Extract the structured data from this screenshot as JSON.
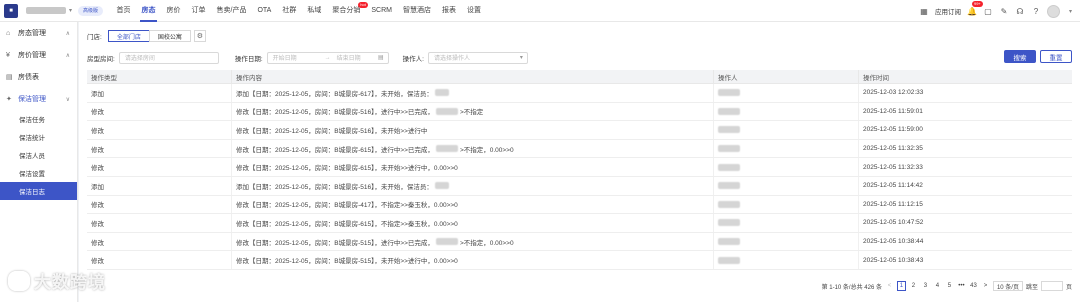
{
  "topbar": {
    "badge": "高级版",
    "nav": [
      "首页",
      "房态",
      "房价",
      "订单",
      "售卖/产品",
      "OTA",
      "社群",
      "私域",
      "聚合分销",
      "SCRM",
      "智慧酒店",
      "报表",
      "设置"
    ],
    "nav_active_index": 1,
    "hot_label": "hot",
    "hot_index": 8,
    "subscribe_label": "应用订阅",
    "notif_count": "99+"
  },
  "sidebar": {
    "items": [
      {
        "label": "房态管理",
        "icon": "home-icon",
        "chevron": "∧"
      },
      {
        "label": "房价管理",
        "icon": "price-icon",
        "chevron": "∧"
      },
      {
        "label": "房债表",
        "icon": "table-icon",
        "chevron": ""
      },
      {
        "label": "保洁管理",
        "icon": "broom-icon",
        "chevron": "∨"
      }
    ],
    "sub_items": [
      "保洁任务",
      "保洁统计",
      "保洁人员",
      "保洁设置",
      "保洁日志"
    ],
    "active_sub_index": 4
  },
  "filters": {
    "store_label": "门店:",
    "store_options": [
      "全部门店",
      "国校公寓"
    ],
    "room_label": "房型房间:",
    "room_placeholder": "请选择房间",
    "date_label": "操作日期:",
    "date_start_placeholder": "开始日期",
    "date_sep": "→",
    "date_end_placeholder": "结束日期",
    "operator_label": "操作人:",
    "operator_placeholder": "请选择操作人",
    "search_btn": "搜索",
    "reset_btn": "重置"
  },
  "table": {
    "headers": [
      "操作类型",
      "操作内容",
      "操作人",
      "操作时间"
    ],
    "rows": [
      {
        "type": "添加",
        "content_a": "添加【日期：2025-12-05，房间：B城景房-617】，未开始，保洁员：",
        "content_b": "",
        "time": "2025-12-03 12:02:33"
      },
      {
        "type": "修改",
        "content_a": "修改【日期：2025-12-05，房间：B城景房-516】，进行中>>已完成，",
        "content_b": ">不指定",
        "time": "2025-12-05 11:59:01"
      },
      {
        "type": "修改",
        "content_a": "修改【日期：2025-12-05，房间：B城景房-516】，未开始>>进行中",
        "content_b": "",
        "time": "2025-12-05 11:59:00"
      },
      {
        "type": "修改",
        "content_a": "修改【日期：2025-12-05，房间：B城景房-615】，进行中>>已完成，",
        "content_b": ">不指定，0.00>>0",
        "time": "2025-12-05 11:32:35"
      },
      {
        "type": "修改",
        "content_a": "修改【日期：2025-12-05，房间：B城景房-615】，未开始>>进行中，0.00>>0",
        "content_b": "",
        "time": "2025-12-05 11:32:33"
      },
      {
        "type": "添加",
        "content_a": "添加【日期：2025-12-05，房间：B城景房-516】，未开始，保洁员：",
        "content_b": "",
        "time": "2025-12-05 11:14:42"
      },
      {
        "type": "修改",
        "content_a": "修改【日期：2025-12-05，房间：B城景房-417】，不指定>>秦玉秋，0.00>>0",
        "content_b": "",
        "time": "2025-12-05 11:12:15"
      },
      {
        "type": "修改",
        "content_a": "修改【日期：2025-12-05，房间：B城景房-615】，不指定>>秦玉秋，0.00>>0",
        "content_b": "",
        "time": "2025-12-05 10:47:52"
      },
      {
        "type": "修改",
        "content_a": "修改【日期：2025-12-05，房间：B城景房-515】，进行中>>已完成，",
        "content_b": ">不指定，0.00>>0",
        "time": "2025-12-05 10:38:44"
      },
      {
        "type": "修改",
        "content_a": "修改【日期：2025-12-05，房间：B城景房-515】，未开始>>进行中，0.00>>0",
        "content_b": "",
        "time": "2025-12-05 10:38:43"
      }
    ]
  },
  "pagination": {
    "summary": "第 1-10 条/总共 426 条",
    "prev": "<",
    "pages": [
      "1",
      "2",
      "3",
      "4",
      "5",
      "•••",
      "43"
    ],
    "next": ">",
    "page_size": "10 条/页",
    "jump_label": "跳至",
    "jump_suffix": "页"
  },
  "watermark": "大数跨境",
  "colors": {
    "accent": "#3d55c7"
  }
}
